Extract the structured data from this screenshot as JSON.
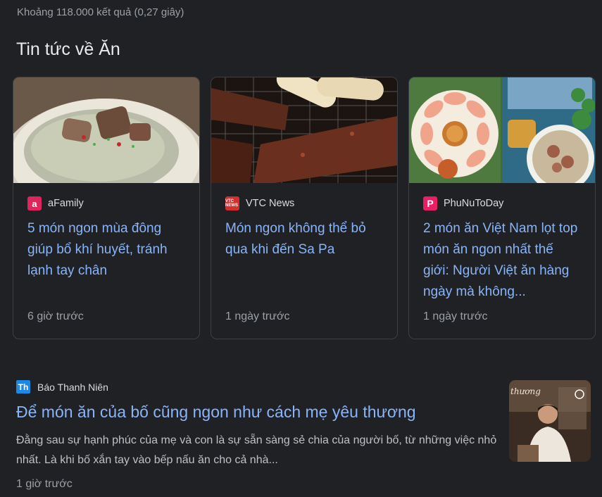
{
  "results_stats": "Khoảng 118.000 kết quả (0,27 giây)",
  "section_title": "Tin tức về Ăn",
  "cards": [
    {
      "source": "aFamily",
      "logo_text": "a",
      "headline": "5 món ngon mùa đông giúp bổ khí huyết, tránh lạnh tay chân",
      "time": "6 giờ trước"
    },
    {
      "source": "VTC News",
      "logo_text": "VTC NEWS",
      "headline": "Món ngon không thể bỏ qua khi đến Sa Pa",
      "time": "1 ngày trước"
    },
    {
      "source": "PhuNuToDay",
      "logo_text": "P",
      "headline": "2 món ăn Việt Nam lọt top món ăn ngon nhất thế giới: Người Việt ăn hàng ngày mà không...",
      "time": "1 ngày trước"
    }
  ],
  "article": {
    "source": "Báo Thanh Niên",
    "logo_text": "Th",
    "title": "Để món ăn của bố cũng ngon như cách mẹ yêu thương",
    "snippet": "Đằng sau sự hạnh phúc của mẹ và con là sự sẵn sàng sẻ chia của người bố, từ những việc nhỏ nhất. Là khi bố xắn tay vào bếp nấu ăn cho cả nhà...",
    "time": "1 giờ trước",
    "thumb_caption": "thương"
  }
}
